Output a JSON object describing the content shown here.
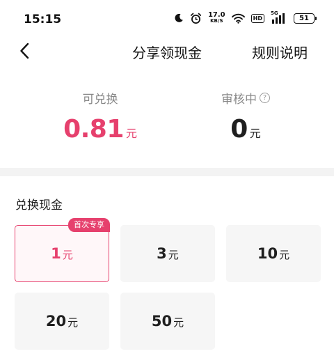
{
  "status_bar": {
    "time": "15:15",
    "net_speed_value": "17.0",
    "net_speed_unit": "KB/S",
    "hd_label": "HD",
    "signal_label": "5G",
    "battery_level": "51",
    "icons": [
      "moon-icon",
      "alarm-icon",
      "wifi-icon",
      "hd-icon",
      "signal-icon",
      "battery-icon"
    ]
  },
  "nav": {
    "title": "分享领现金",
    "rules_label": "规则说明",
    "back_icon": "chevron-left-icon"
  },
  "balance": {
    "available_label": "可兑换",
    "available_value": "0.81",
    "available_unit": "元",
    "pending_label": "审核中",
    "pending_value": "0",
    "pending_unit": "元",
    "help_icon": "question-circle-icon"
  },
  "exchange": {
    "title": "兑换现金",
    "options": [
      {
        "amount": "1",
        "unit": "元",
        "badge": "首次专享",
        "selected": true
      },
      {
        "amount": "3",
        "unit": "元"
      },
      {
        "amount": "10",
        "unit": "元"
      },
      {
        "amount": "20",
        "unit": "元"
      },
      {
        "amount": "50",
        "unit": "元"
      }
    ]
  },
  "colors": {
    "accent": "#e6406d",
    "card_bg": "#f6f6f6",
    "divider": "#f3f3f3"
  }
}
